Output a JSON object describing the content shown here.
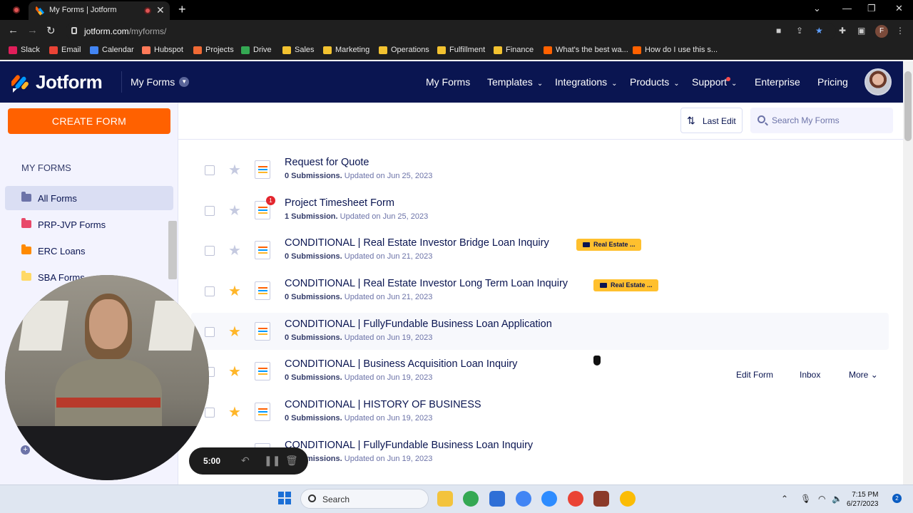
{
  "browser": {
    "tab_title": "My Forms | Jotform",
    "url_host": "jotform.com",
    "url_path": "/myforms/",
    "profile_initial": "F",
    "bookmarks": [
      "Slack",
      "Email",
      "Calendar",
      "Hubspot",
      "Projects",
      "Drive",
      "Sales",
      "Marketing",
      "Operations",
      "Fulfillment",
      "Finance",
      "What's the best wa...",
      "How do I use this s..."
    ]
  },
  "header": {
    "logo_text": "Jotform",
    "section": "My Forms",
    "nav": [
      "My Forms",
      "Templates",
      "Integrations",
      "Products",
      "Support",
      "Enterprise",
      "Pricing"
    ]
  },
  "sidebar": {
    "create_label": "CREATE FORM",
    "title": "MY FORMS",
    "items": [
      {
        "label": "All Forms",
        "color": "#6c73a8"
      },
      {
        "label": "PRP-JVP Forms",
        "color": "#e8496a"
      },
      {
        "label": "ERC Loans",
        "color": "#ff8a00"
      },
      {
        "label": "SBA Forms",
        "color": "#ffd966"
      }
    ]
  },
  "toolbar": {
    "sort_label": "Last Edit",
    "search_placeholder": "Search My Forms"
  },
  "forms": [
    {
      "title": "Request for Quote",
      "count": "0 Submissions.",
      "updated": "Updated on Jun 25, 2023",
      "starred": false
    },
    {
      "title": "Project Timesheet Form",
      "count": "1 Submission.",
      "updated": "Updated on Jun 25, 2023",
      "starred": false,
      "badge": "1"
    },
    {
      "title": "CONDITIONAL | Real Estate Investor Bridge Loan Inquiry",
      "count": "0 Submissions.",
      "updated": "Updated on Jun 21, 2023",
      "starred": false,
      "tag": "Real Estate ..."
    },
    {
      "title": "CONDITIONAL | Real Estate Investor Long Term Loan Inquiry",
      "count": "0 Submissions.",
      "updated": "Updated on Jun 21, 2023",
      "starred": true,
      "tag": "Real Estate ..."
    },
    {
      "title": "CONDITIONAL | FullyFundable Business Loan Application",
      "count": "0 Submissions.",
      "updated": "Updated on Jun 19, 2023",
      "starred": true
    },
    {
      "title": "CONDITIONAL | Business Acquisition Loan Inquiry",
      "count": "0 Submissions.",
      "updated": "Updated on Jun 19, 2023",
      "starred": true
    },
    {
      "title": "CONDITIONAL | HISTORY OF BUSINESS",
      "count": "0 Submissions.",
      "updated": "Updated on Jun 19, 2023",
      "starred": true
    },
    {
      "title": "CONDITIONAL | FullyFundable Business Loan Inquiry",
      "count": "0 Submissions.",
      "updated": "Updated on Jun 19, 2023",
      "starred": false
    }
  ],
  "row_actions": {
    "edit": "Edit Form",
    "inbox": "Inbox",
    "more": "More"
  },
  "recorder": {
    "time": "5:00"
  },
  "taskbar": {
    "search_label": "Search",
    "time": "7:15 PM",
    "date": "6/27/2023",
    "notifications": "2"
  }
}
